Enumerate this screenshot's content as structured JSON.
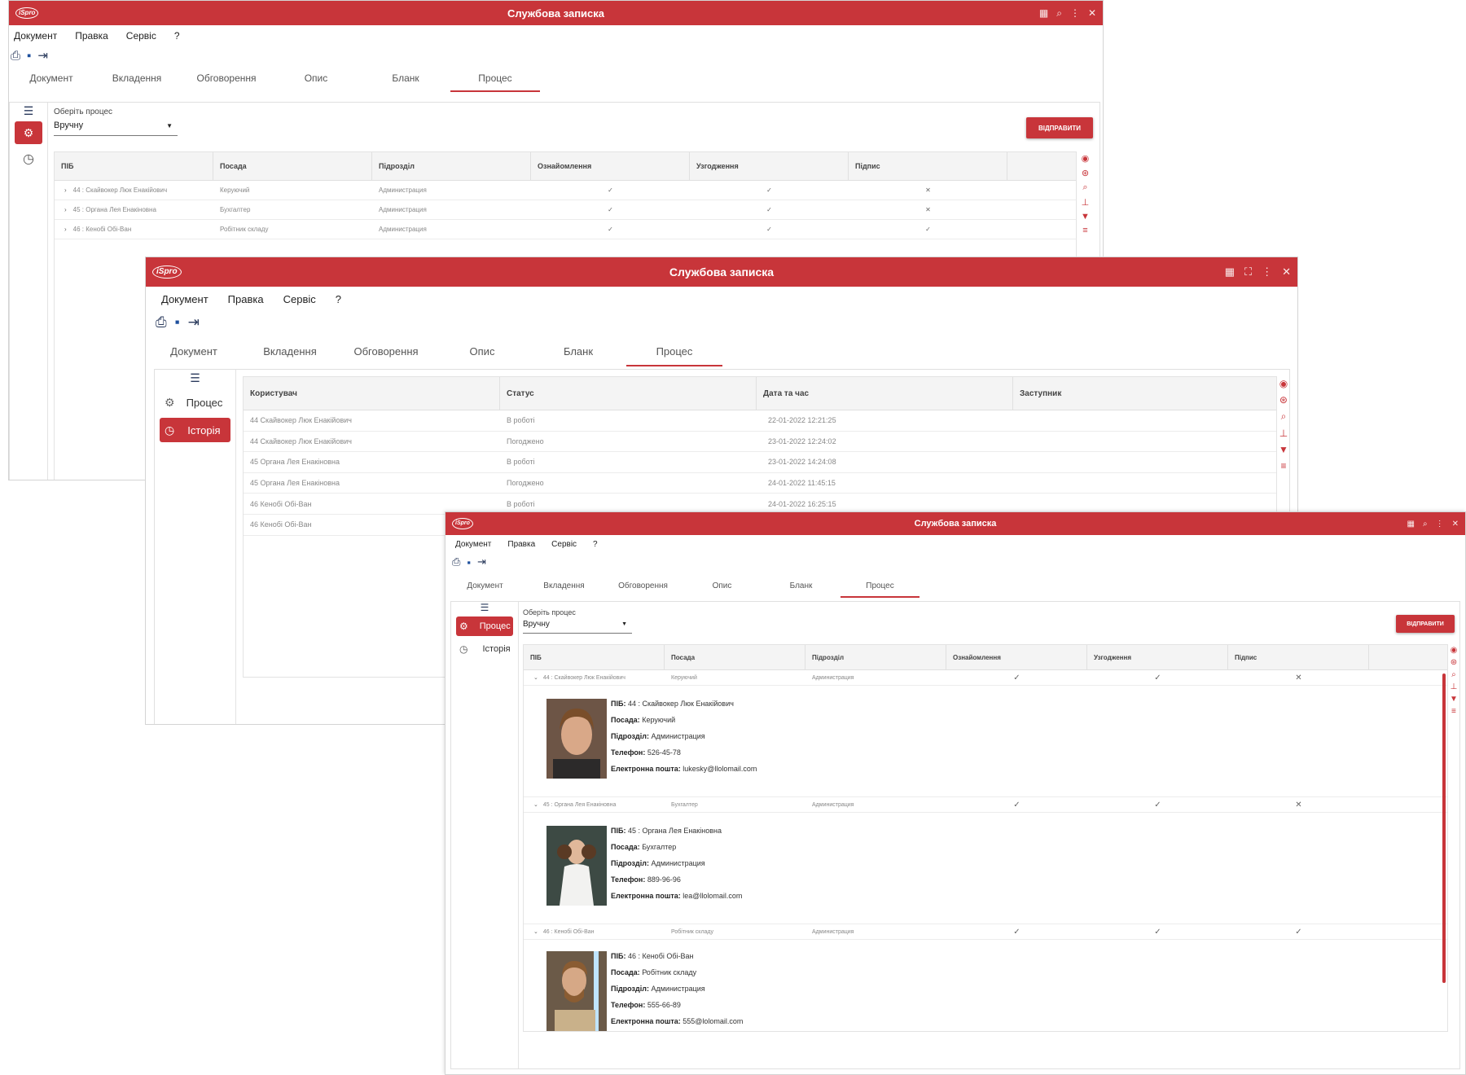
{
  "window_title": "Службова записка",
  "logo": "iSpro",
  "title_controls": [
    "grid-icon",
    "search-icon",
    "dots-icon",
    "close-icon"
  ],
  "menu": [
    "Документ",
    "Правка",
    "Сервіс",
    "?"
  ],
  "toolbar_icons": [
    "print-icon",
    "save-icon",
    "exit-icon"
  ],
  "tabs": [
    "Документ",
    "Вкладення",
    "Обговорення",
    "Опис",
    "Бланк",
    "Процес"
  ],
  "active_tab": "Процес",
  "sidebar": {
    "process": "Процес",
    "history": "Історія"
  },
  "process_select": {
    "label": "Оберіть процес",
    "value": "Вручну"
  },
  "send_button": "ВІДПРАВИТИ",
  "process_grid": {
    "columns": [
      "ПІБ",
      "Посада",
      "Підрозділ",
      "Ознайомлення",
      "Узгодження",
      "Підпис"
    ],
    "rows": [
      {
        "name": "44 : Скайвокер Люк Енакійович",
        "position": "Керуючий",
        "dept": "Администрация",
        "ack": "✓",
        "agree": "✓",
        "sign": "✕"
      },
      {
        "name": "45 : Органа Лея Енакіновна",
        "position": "Бухгалтер",
        "dept": "Администрация",
        "ack": "✓",
        "agree": "✓",
        "sign": "✕"
      },
      {
        "name": "46 : Кенобі Обі-Ван",
        "position": "Робітник складу",
        "dept": "Администрация",
        "ack": "✓",
        "agree": "✓",
        "sign": "✓"
      }
    ]
  },
  "history_grid": {
    "columns": [
      "Користувач",
      "Статус",
      "Дата та час",
      "Заступник"
    ],
    "rows": [
      {
        "user": "44 Скайвокер Люк Енакійович",
        "status": "В роботі",
        "datetime": "22-01-2022 12:21:25"
      },
      {
        "user": "44 Скайвокер Люк Енакійович",
        "status": "Погоджено",
        "datetime": "23-01-2022 12:24:02"
      },
      {
        "user": "45 Органа Лея Енакіновна",
        "status": "В роботі",
        "datetime": "23-01-2022 14:24:08"
      },
      {
        "user": "45 Органа Лея Енакіновна",
        "status": "Погоджено",
        "datetime": "24-01-2022 11:45:15"
      },
      {
        "user": "46 Кенобі Обі-Ван",
        "status": "В роботі",
        "datetime": "24-01-2022 16:25:15"
      },
      {
        "user": "46 Кенобі Обі-Ван",
        "status": "",
        "datetime": ""
      }
    ]
  },
  "detail_labels": {
    "name": "ПІБ:",
    "position": "Посада:",
    "dept": "Підрозділ:",
    "phone": "Телефон:",
    "email": "Електронна пошта:"
  },
  "details": [
    {
      "name": "44 : Скайвокер Люк Енакійович",
      "position": "Керуючий",
      "dept": "Администрация",
      "phone": "526-45-78",
      "email": "lukesky@llolomail.com"
    },
    {
      "name": "45 : Органа Лея Енакіновна",
      "position": "Бухгалтер",
      "dept": "Администрация",
      "phone": "889-96-96",
      "email": "lea@llolomail.com"
    },
    {
      "name": "46 : Кенобі Обі-Ван",
      "position": "Робітник складу",
      "dept": "Администрация",
      "phone": "555-66-89",
      "email": "555@lolomail.com"
    }
  ],
  "grid_tools": [
    "eye-icon",
    "life-ring-icon",
    "search-icon",
    "pin-icon",
    "filter-icon",
    "sort-icon"
  ],
  "colors": {
    "accent": "#c8353a",
    "header_bg": "#f4f4f4"
  }
}
